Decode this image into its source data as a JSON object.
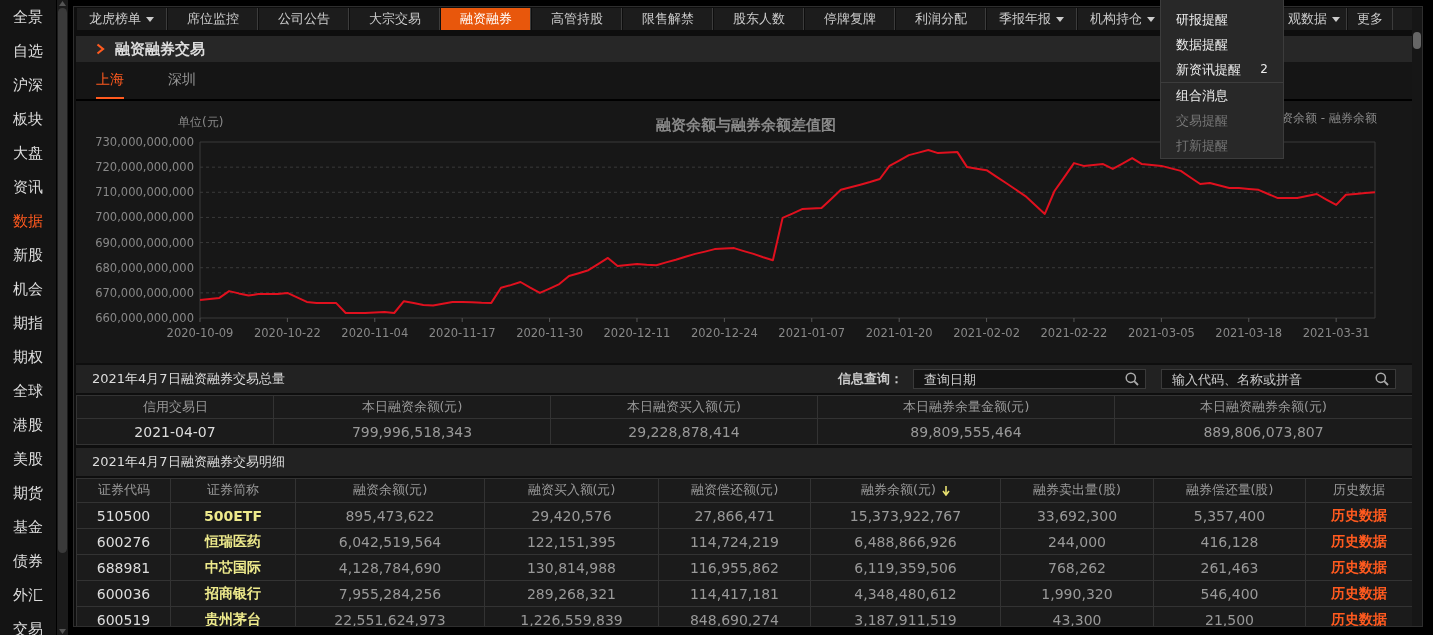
{
  "sidebar": {
    "items": [
      {
        "label": "全景",
        "selected": false
      },
      {
        "label": "自选",
        "selected": false
      },
      {
        "label": "沪深",
        "selected": false
      },
      {
        "label": "板块",
        "selected": false
      },
      {
        "label": "大盘",
        "selected": false
      },
      {
        "label": "资讯",
        "selected": false
      },
      {
        "label": "数据",
        "selected": true
      },
      {
        "label": "新股",
        "selected": false
      },
      {
        "label": "机会",
        "selected": false
      },
      {
        "label": "期指",
        "selected": false
      },
      {
        "label": "期权",
        "selected": false
      },
      {
        "label": "全球",
        "selected": false
      },
      {
        "label": "港股",
        "selected": false
      },
      {
        "label": "美股",
        "selected": false
      },
      {
        "label": "期货",
        "selected": false
      },
      {
        "label": "基金",
        "selected": false
      },
      {
        "label": "债券",
        "selected": false
      },
      {
        "label": "外汇",
        "selected": false
      },
      {
        "label": "交易",
        "selected": false
      }
    ]
  },
  "nav_tabs": [
    {
      "label": "龙虎榜单",
      "dropdown": true,
      "selected": false
    },
    {
      "label": "席位监控",
      "dropdown": false,
      "selected": false
    },
    {
      "label": "公司公告",
      "dropdown": false,
      "selected": false
    },
    {
      "label": "大宗交易",
      "dropdown": false,
      "selected": false
    },
    {
      "label": "融资融券",
      "dropdown": false,
      "selected": true
    },
    {
      "label": "高管持股",
      "dropdown": false,
      "selected": false
    },
    {
      "label": "限售解禁",
      "dropdown": false,
      "selected": false
    },
    {
      "label": "股东人数",
      "dropdown": false,
      "selected": false
    },
    {
      "label": "停牌复牌",
      "dropdown": false,
      "selected": false
    },
    {
      "label": "利润分配",
      "dropdown": false,
      "selected": false
    },
    {
      "label": "季报年报",
      "dropdown": true,
      "selected": false
    },
    {
      "label": "机构持仓",
      "dropdown": true,
      "selected": false
    },
    {
      "label": "观数据",
      "dropdown": true,
      "selected": false
    },
    {
      "label": "更多",
      "dropdown": false,
      "selected": false
    }
  ],
  "section": {
    "title": "融资融券交易"
  },
  "region_tabs": [
    {
      "label": "上海",
      "selected": true
    },
    {
      "label": "深圳",
      "selected": false
    }
  ],
  "chart": {
    "chart_data": {
      "type": "line",
      "title": "融资余额与融券余额差值图",
      "ylabel": "单位(元)",
      "categories": [
        "2020-10-09",
        null,
        null,
        null,
        null,
        null,
        null,
        null,
        null,
        "2020-10-22",
        null,
        null,
        null,
        null,
        null,
        null,
        null,
        null,
        "2020-11-04",
        null,
        null,
        null,
        null,
        null,
        null,
        null,
        null,
        "2020-11-17",
        null,
        null,
        null,
        null,
        null,
        null,
        null,
        null,
        "2020-11-30",
        null,
        null,
        null,
        null,
        null,
        null,
        null,
        null,
        "2020-12-11",
        null,
        null,
        null,
        null,
        null,
        null,
        null,
        null,
        "2020-12-24",
        null,
        null,
        null,
        null,
        null,
        null,
        null,
        null,
        "2021-01-07",
        null,
        null,
        null,
        null,
        null,
        null,
        null,
        null,
        "2021-01-20",
        null,
        null,
        null,
        null,
        null,
        null,
        null,
        null,
        "2021-02-02",
        null,
        null,
        null,
        null,
        null,
        null,
        null,
        null,
        "2021-02-22",
        null,
        null,
        null,
        null,
        null,
        null,
        null,
        null,
        "2021-03-05",
        null,
        null,
        null,
        null,
        null,
        null,
        null,
        null,
        "2021-03-18",
        null,
        null,
        null,
        null,
        null,
        null,
        null,
        null,
        "2021-03-31",
        null,
        null,
        null,
        null
      ],
      "series": [
        {
          "name": "资余额 - 融券余额",
          "color": "#e0101e",
          "values": [
            667200000000.0,
            667600000000.0,
            668000000000.0,
            670700000000.0,
            669800000000.0,
            669000000000.0,
            669500000000.0,
            669500000000.0,
            669500000000.0,
            670000000000.0,
            668200000000.0,
            666400000000.0,
            666000000000.0,
            666000000000.0,
            666000000000.0,
            662000000000.0,
            662000000000.0,
            662000000000.0,
            662200000000.0,
            662400000000.0,
            662000000000.0,
            666700000000.0,
            666000000000.0,
            665200000000.0,
            665000000000.0,
            665700000000.0,
            666400000000.0,
            666400000000.0,
            666300000000.0,
            666100000000.0,
            666000000000.0,
            672000000000.0,
            673100000000.0,
            674300000000.0,
            672100000000.0,
            670000000000.0,
            671700000000.0,
            673500000000.0,
            676700000000.0,
            677800000000.0,
            679000000000.0,
            681400000000.0,
            683900000000.0,
            680700000000.0,
            681100000000.0,
            681500000000.0,
            681200000000.0,
            681000000000.0,
            682100000000.0,
            683200000000.0,
            684400000000.0,
            685500000000.0,
            686400000000.0,
            687400000000.0,
            687600000000.0,
            687800000000.0,
            686600000000.0,
            685500000000.0,
            684200000000.0,
            683000000000.0,
            699800000000.0,
            701500000000.0,
            703300000000.0,
            703500000000.0,
            703700000000.0,
            707300000000.0,
            711000000000.0,
            712000000000.0,
            713000000000.0,
            714100000000.0,
            715300000000.0,
            720500000000.0,
            722600000000.0,
            724800000000.0,
            725800000000.0,
            726800000000.0,
            725600000000.0,
            725800000000.0,
            726000000000.0,
            720000000000.0,
            719400000000.0,
            718800000000.0,
            716200000000.0,
            713700000000.0,
            711100000000.0,
            708500000000.0,
            704900000000.0,
            701400000000.0,
            710500000000.0,
            716000000000.0,
            721600000000.0,
            720500000000.0,
            720800000000.0,
            721200000000.0,
            719300000000.0,
            721400000000.0,
            723600000000.0,
            721200000000.0,
            720800000000.0,
            720500000000.0,
            719500000000.0,
            718500000000.0,
            715900000000.0,
            713300000000.0,
            713700000000.0,
            712700000000.0,
            711700000000.0,
            711700000000.0,
            711300000000.0,
            711000000000.0,
            709300000000.0,
            707700000000.0,
            707700000000.0,
            707700000000.0,
            708500000000.0,
            709300000000.0,
            707100000000.0,
            705000000000.0,
            709000000000.0,
            709300000000.0,
            709700000000.0,
            710000000000.0
          ]
        }
      ],
      "ylim": [
        660000000000.0,
        730000000000.0
      ],
      "grid": true,
      "yticks": [
        {
          "value": 660000000000.0,
          "label": "660,000,000,000"
        },
        {
          "value": 670000000000.0,
          "label": "670,000,000,000"
        },
        {
          "value": 680000000000.0,
          "label": "680,000,000,000"
        },
        {
          "value": 690000000000.0,
          "label": "690,000,000,000"
        },
        {
          "value": 700000000000.0,
          "label": "700,000,000,000"
        },
        {
          "value": 710000000000.0,
          "label": "710,000,000,000"
        },
        {
          "value": 720000000000.0,
          "label": "720,000,000,000"
        },
        {
          "value": 730000000000.0,
          "label": "730,000,000,000"
        }
      ]
    }
  },
  "summary": {
    "title": "2021年4月7日融资融券交易总量",
    "query_label": "信息查询：",
    "date_field": {
      "placeholder": "查询日期"
    },
    "code_field": {
      "placeholder": "输入代码、名称或拼音"
    },
    "columns": [
      "信用交易日",
      "本日融资余额(元)",
      "本日融资买入额(元)",
      "本日融券余量金额(元)",
      "本日融资融券余额(元)"
    ],
    "rows": [
      [
        "2021-04-07",
        "799,996,518,343",
        "29,228,878,414",
        "89,809,555,464",
        "889,806,073,807"
      ]
    ]
  },
  "detail": {
    "title": "2021年4月7日融资融券交易明细",
    "columns": [
      {
        "label": "证券代码",
        "sorted": false
      },
      {
        "label": "证券简称",
        "sorted": false
      },
      {
        "label": "融资余额(元)",
        "sorted": false
      },
      {
        "label": "融资买入额(元)",
        "sorted": false
      },
      {
        "label": "融资偿还额(元)",
        "sorted": false
      },
      {
        "label": "融券余额(元)",
        "sorted": true
      },
      {
        "label": "融券卖出量(股)",
        "sorted": false
      },
      {
        "label": "融券偿还量(股)",
        "sorted": false
      },
      {
        "label": "历史数据",
        "sorted": false
      }
    ],
    "rows": [
      [
        "510500",
        "500ETF",
        "895,473,622",
        "29,420,576",
        "27,866,471",
        "15,373,922,767",
        "33,692,300",
        "5,357,400",
        "历史数据"
      ],
      [
        "600276",
        "恒瑞医药",
        "6,042,519,564",
        "122,151,395",
        "114,724,219",
        "6,488,866,926",
        "244,000",
        "416,128",
        "历史数据"
      ],
      [
        "688981",
        "中芯国际",
        "4,128,784,690",
        "130,814,988",
        "116,955,862",
        "6,119,359,506",
        "768,262",
        "261,463",
        "历史数据"
      ],
      [
        "600036",
        "招商银行",
        "7,955,284,256",
        "289,268,321",
        "114,417,181",
        "4,348,480,612",
        "1,990,320",
        "546,400",
        "历史数据"
      ],
      [
        "600519",
        "贵州茅台",
        "22,551,624,973",
        "1,226,559,839",
        "848,690,274",
        "3,187,911,519",
        "43,300",
        "21,500",
        "历史数据"
      ]
    ]
  },
  "menu": {
    "sections": [
      {
        "items": [
          {
            "label": "研报提醒",
            "disabled": false
          },
          {
            "label": "数据提醒",
            "disabled": false
          },
          {
            "label": "新资讯提醒",
            "disabled": false,
            "badge": "2"
          }
        ]
      },
      {
        "items": [
          {
            "label": "组合消息",
            "disabled": false
          },
          {
            "label": "交易提醒",
            "disabled": true
          },
          {
            "label": "打新提醒",
            "disabled": true
          }
        ]
      }
    ]
  }
}
